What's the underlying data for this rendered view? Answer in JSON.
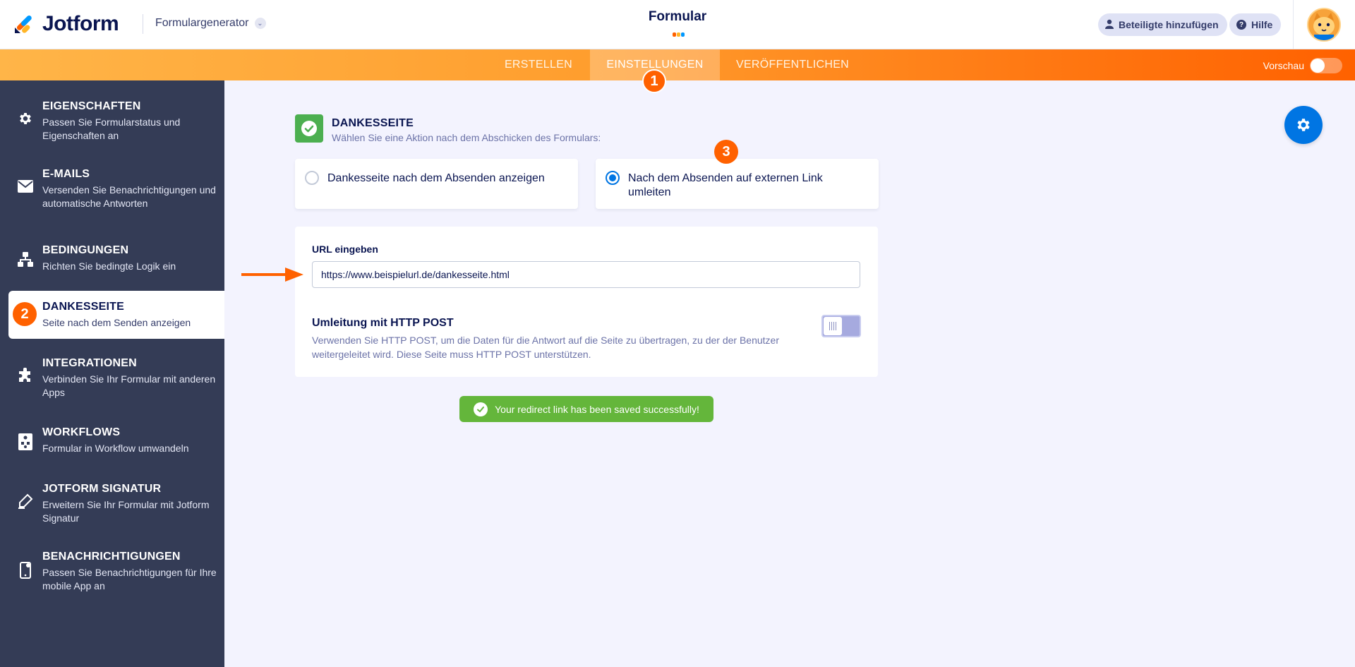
{
  "header": {
    "logo_text": "Jotform",
    "builder_label": "Formulargenerator",
    "form_title": "Formular",
    "add_participants_label": "Beteiligte hinzufügen",
    "help_label": "Hilfe"
  },
  "nav": {
    "tabs": [
      {
        "label": "ERSTELLEN",
        "active": false
      },
      {
        "label": "EINSTELLUNGEN",
        "active": true
      },
      {
        "label": "VERÖFFENTLICHEN",
        "active": false
      }
    ],
    "preview_label": "Vorschau"
  },
  "badges": [
    "1",
    "2",
    "3"
  ],
  "sidebar": {
    "items": [
      {
        "title": "EIGENSCHAFTEN",
        "desc": "Passen Sie Formularstatus und Eigenschaften an",
        "icon": "gear-icon"
      },
      {
        "title": "E-MAILS",
        "desc": "Versenden Sie Benachrichtigungen und automatische Antworten",
        "icon": "envelope-icon"
      },
      {
        "title": "BEDINGUNGEN",
        "desc": "Richten Sie bedingte Logik ein",
        "icon": "sitemap-icon"
      },
      {
        "title": "DANKESSEITE",
        "desc": "Seite nach dem Senden anzeigen",
        "icon": "step-badge",
        "active": true
      },
      {
        "title": "INTEGRATIONEN",
        "desc": "Verbinden Sie Ihr Formular mit anderen Apps",
        "icon": "puzzle-icon"
      },
      {
        "title": "WORKFLOWS",
        "desc": "Formular in Workflow umwandeln",
        "icon": "workflow-icon"
      },
      {
        "title": "JOTFORM SIGNATUR",
        "desc": "Erweitern Sie Ihr Formular mit Jotform Signatur",
        "icon": "pen-icon"
      },
      {
        "title": "BENACHRICHTIGUNGEN",
        "desc": "Passen Sie Benachrichtigungen für Ihre mobile App an",
        "icon": "mobile-icon"
      }
    ]
  },
  "main": {
    "section_title": "DANKESSEITE",
    "section_subtitle": "Wählen Sie eine Aktion nach dem Abschicken des Formulars:",
    "options": [
      {
        "label": "Dankesseite nach dem Absenden anzeigen",
        "selected": false
      },
      {
        "label": "Nach dem Absenden auf externen Link umleiten",
        "selected": true
      }
    ],
    "url_label": "URL eingeben",
    "url_value": "https://www.beispielurl.de/dankesseite.html",
    "post_title": "Umleitung mit HTTP POST",
    "post_desc": "Verwenden Sie HTTP POST, um die Daten für die Antwort auf die Seite zu übertragen, zu der der Benutzer weitergeleitet wird. Diese Seite muss HTTP POST unterstützen.",
    "post_enabled": false,
    "toast": "Your redirect link has been saved successfully!"
  },
  "colors": {
    "accent_orange": "#ff6100",
    "primary_blue": "#0075e3",
    "success_green": "#64b63b",
    "sidebar_bg": "#343c56"
  }
}
